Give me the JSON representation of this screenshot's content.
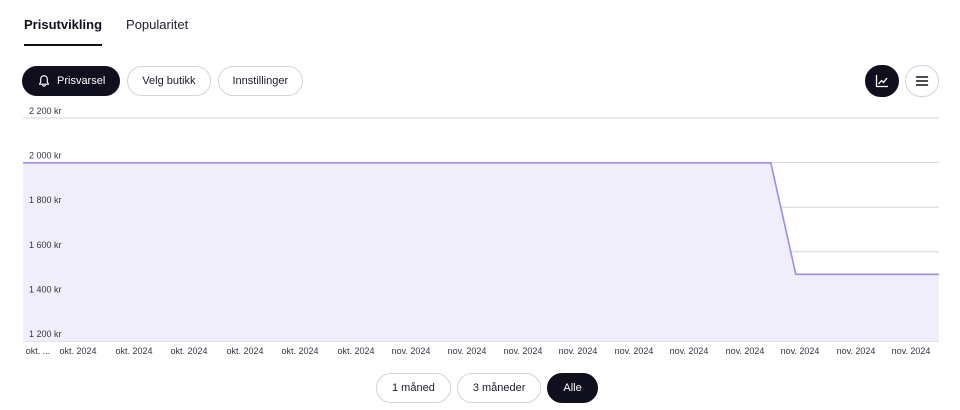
{
  "tabs": [
    {
      "label": "Prisutvikling",
      "active": true
    },
    {
      "label": "Popularitet",
      "active": false
    }
  ],
  "toolbar": {
    "price_alert": "Prisvarsel",
    "select_store": "Velg butikk",
    "settings": "Innstillinger"
  },
  "view_toggle": {
    "chart_icon": "line-chart-icon",
    "list_icon": "hamburger-list-icon",
    "active": "chart"
  },
  "range_buttons": [
    {
      "label": "1 måned",
      "active": false
    },
    {
      "label": "3 måneder",
      "active": false
    },
    {
      "label": "Alle",
      "active": true
    }
  ],
  "colors": {
    "line": "#9b8cf0",
    "fill": "#f1eefc",
    "dark": "#0f0f1e",
    "grid": "#d6d6dc"
  },
  "chart_data": {
    "type": "area",
    "y_ticks": [
      {
        "value": 2200,
        "label": "2 200 kr"
      },
      {
        "value": 2000,
        "label": "2 000 kr"
      },
      {
        "value": 1800,
        "label": "1 800 kr"
      },
      {
        "value": 1600,
        "label": "1 600 kr"
      },
      {
        "value": 1400,
        "label": "1 400 kr"
      },
      {
        "value": 1200,
        "label": "1 200 kr"
      }
    ],
    "ylim": [
      1200,
      2200
    ],
    "x_tick_labels": [
      "okt. ...",
      "okt. 2024",
      "okt. 2024",
      "okt. 2024",
      "okt. 2024",
      "okt. 2024",
      "okt. 2024",
      "nov. 2024",
      "nov. 2024",
      "nov. 2024",
      "nov. 2024",
      "nov. 2024",
      "nov. 2024",
      "nov. 2024",
      "nov. 2024",
      "nov. 2024",
      "nov. 2024"
    ],
    "series": [
      {
        "points": [
          {
            "x": 0,
            "y": 1999
          },
          {
            "x": 13.47,
            "y": 1999
          },
          {
            "x": 13.92,
            "y": 1499
          },
          {
            "x": 16.5,
            "y": 1499
          }
        ]
      }
    ],
    "xlim": [
      0,
      16.5
    ],
    "grid": true
  }
}
